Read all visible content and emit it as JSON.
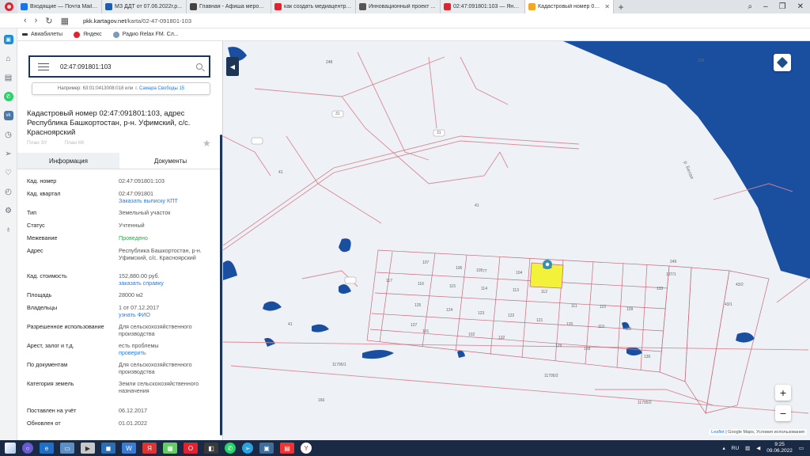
{
  "browser": {
    "tabs": [
      {
        "label": "Входящие — Почта Mail.ru",
        "color": "#1a73e8"
      },
      {
        "label": "МЗ ДДТ от 07.06.2022г.p...",
        "color": "#1a5fb4"
      },
      {
        "label": "Главная - Афиша меропр...",
        "color": "#444"
      },
      {
        "label": "как создать медиацентр в ...",
        "color": "#e0232e"
      },
      {
        "label": "Инновационный проект ...",
        "color": "#555"
      },
      {
        "label": "02:47:091801:103 — Яндек...",
        "color": "#e0232e"
      },
      {
        "label": "Кадастровый номер 02:47:...",
        "color": "#f5a623",
        "active": true
      }
    ],
    "url_domain": "pkk.kartagov.net",
    "url_path": "/karta/02-47-091801-103",
    "bookmarks": [
      "Авиабилеты",
      "Яндекс",
      "Радио Relax FM. Сл..."
    ]
  },
  "panel": {
    "search_value": "02:47:091801:103",
    "hint_text": "Например: 63:01:0413008:018 или",
    "hint_link": "г. Самара Свободы 15",
    "title": "Кадастровый номер 02:47:091801:103, адрес Республика Башкортостан, р-н. Уфимский, с/с. Красноярский",
    "pdf_zu": "План ЗУ",
    "pdf_kk": "План КК",
    "tab_info": "Информация",
    "tab_docs": "Документы",
    "rows": [
      {
        "k": "Кад. номер",
        "v": "02:47:091801:103"
      },
      {
        "k": "Кад. квартал",
        "v": "02:47:091801",
        "link": "Заказать выписку КПТ"
      },
      {
        "k": "Тип",
        "v": "Земельный участок"
      },
      {
        "k": "Статус",
        "v": "Учтенный"
      },
      {
        "k": "Межевание",
        "v_green": "Проведено"
      },
      {
        "k": "Адрес",
        "v": "Республика Башкортостан, р-н. Уфимский, с/с. Красноярский"
      },
      {
        "k": "Кад. стоимость",
        "v": "152,880.00 руб.",
        "link": "заказать справку"
      },
      {
        "k": "Площадь",
        "v": "28000 м2"
      },
      {
        "k": "Владельцы",
        "v": "1 от 07.12.2017",
        "link": "узнать ФИО"
      },
      {
        "k": "Разрешенное использование",
        "v": "Для сельскохозяйственного производства"
      },
      {
        "k": "Арест, залог и т.д.",
        "v": "есть проблемы",
        "link": "проверить"
      },
      {
        "k": "По документам",
        "v": "Для сельскохозяйственного производства"
      },
      {
        "k": "Категория земель",
        "v": "Земли сельскохозяйственного назначения"
      },
      {
        "k": "Поставлен на учёт",
        "v": "06.12.2017"
      },
      {
        "k": "Обновлен от",
        "v": "01.01.2022"
      }
    ]
  },
  "map": {
    "river_label": "р. Белая",
    "attribution_link": "Leaflet",
    "attribution_text": "| Google Maps, Условия использования",
    "labels": [
      "248",
      "268",
      "31",
      "31",
      "41",
      "41",
      "41",
      "11795/1",
      "11795/2",
      "11795/2",
      "166",
      "249",
      "137/1",
      "43/2",
      "43/1",
      "107",
      "106",
      "105",
      "104",
      "77",
      "117",
      "116",
      "115",
      "114",
      "113",
      "112",
      "111",
      "110",
      "109",
      "133",
      "125",
      "124",
      "123",
      "122",
      "121",
      "120",
      "119",
      "118",
      "132",
      "101",
      "102",
      "128",
      "129",
      "130",
      "127",
      "93"
    ],
    "zoom_in": "+",
    "zoom_out": "−"
  },
  "taskbar": {
    "lang": "RU",
    "time": "9:25",
    "date": "09.06.2022"
  }
}
